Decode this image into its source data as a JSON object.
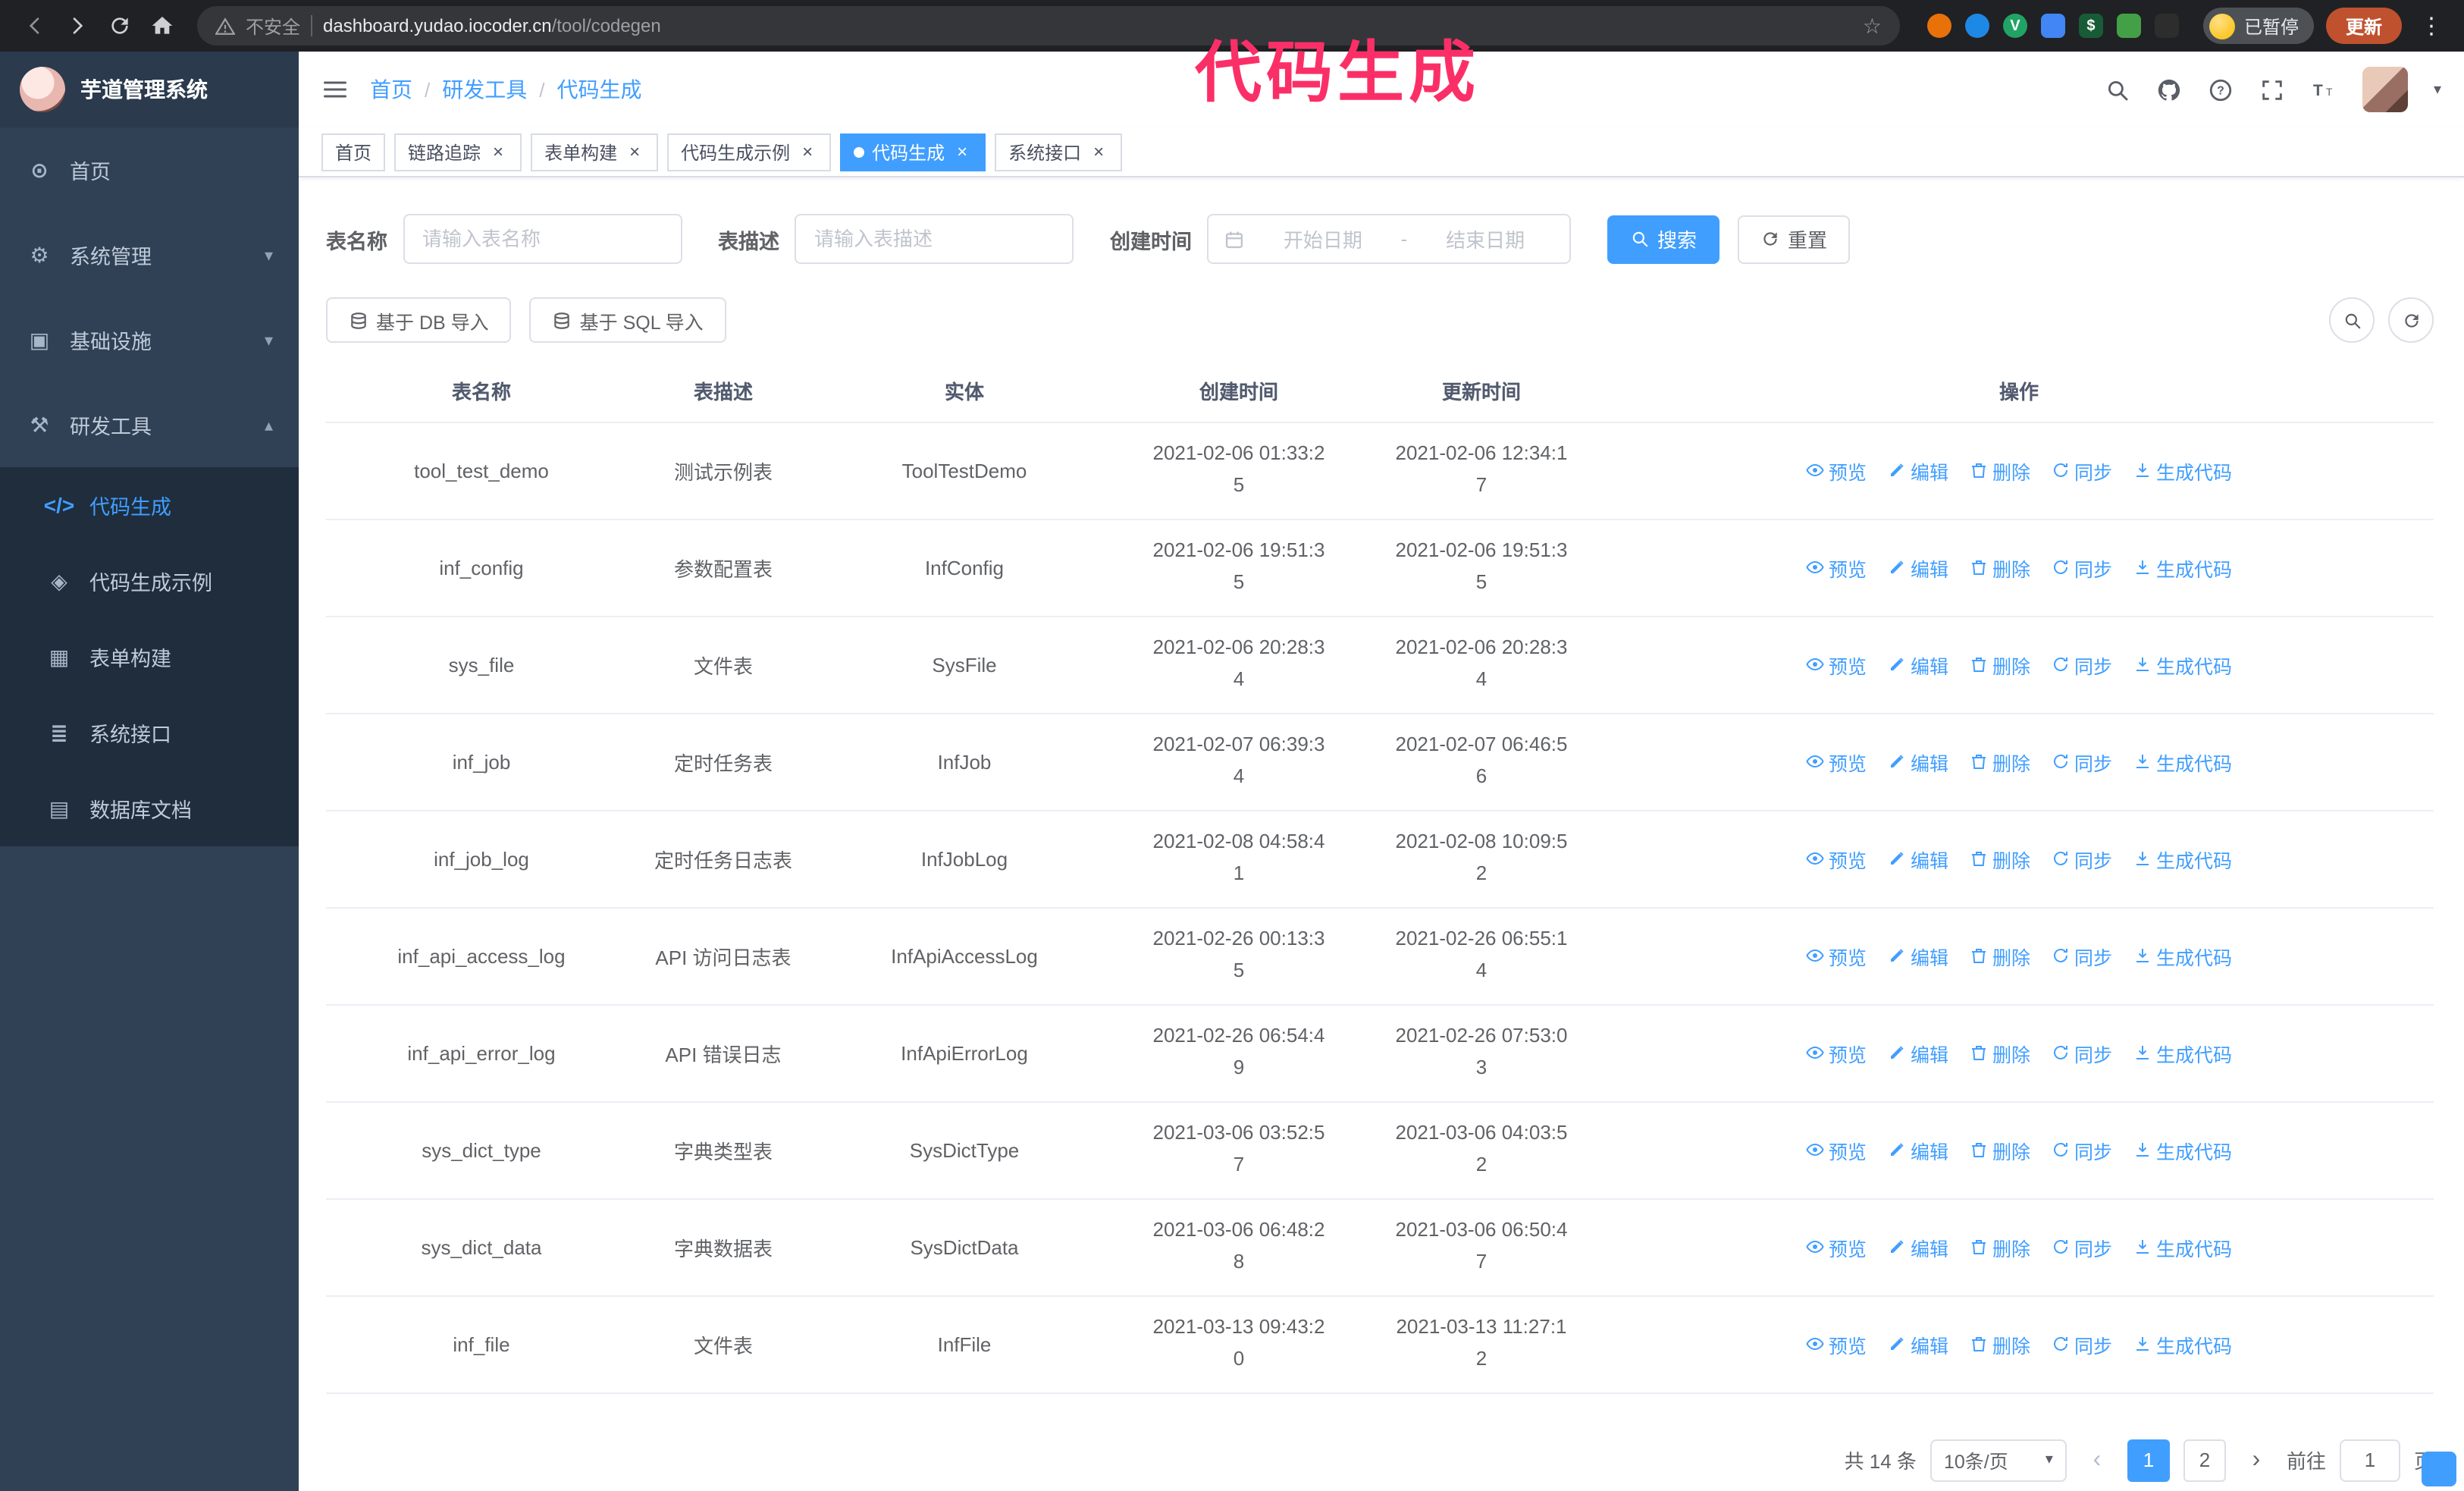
{
  "theme": {
    "primary": "#409EFF",
    "sidebar_bg": "#304156",
    "submenu_bg": "#1f2d3d",
    "overlay_color": "#fb2f67",
    "update_button_color": "#c0512f"
  },
  "browser": {
    "security_label": "不安全",
    "url_host": "dashboard.yudao.iocoder.cn",
    "url_path": "/tool/codegen",
    "paused_badge": "已暂停",
    "update_button": "更新",
    "extensions": [
      {
        "name": "extension-orange-icon",
        "color": "#e8710a",
        "shape": "circle",
        "glyph": ""
      },
      {
        "name": "extension-drop-icon",
        "color": "#1e88e5",
        "shape": "circle",
        "glyph": ""
      },
      {
        "name": "extension-v-green-icon",
        "color": "#21a366",
        "shape": "circle",
        "glyph": "V"
      },
      {
        "name": "extension-grid-blue-icon",
        "color": "#4285f4",
        "shape": "square",
        "glyph": ""
      },
      {
        "name": "extension-dark-green-icon",
        "color": "#185c37",
        "shape": "square",
        "glyph": "$"
      },
      {
        "name": "extension-leaf-icon",
        "color": "#43a047",
        "shape": "square",
        "glyph": ""
      },
      {
        "name": "extension-dark-icon",
        "color": "#2d2d2d",
        "shape": "square",
        "glyph": ""
      }
    ]
  },
  "overlay": {
    "title": "代码生成"
  },
  "sidebar": {
    "app_title": "芋道管理系统",
    "items": [
      {
        "key": "home",
        "label": "首页",
        "icon": "dashboard-icon"
      },
      {
        "key": "system",
        "label": "系统管理",
        "icon": "gear-icon",
        "chevron": "down"
      },
      {
        "key": "infra",
        "label": "基础设施",
        "icon": "monitor-icon",
        "chevron": "down"
      },
      {
        "key": "devtools",
        "label": "研发工具",
        "icon": "tools-icon",
        "chevron": "up",
        "open": true
      }
    ],
    "subitems": [
      {
        "key": "codegen",
        "label": "代码生成",
        "icon": "code-icon",
        "active": true
      },
      {
        "key": "codegen-example",
        "label": "代码生成示例",
        "icon": "example-icon"
      },
      {
        "key": "form-builder",
        "label": "表单构建",
        "icon": "form-icon"
      },
      {
        "key": "system-api",
        "label": "系统接口",
        "icon": "api-icon"
      },
      {
        "key": "db-doc",
        "label": "数据库文档",
        "icon": "database-icon"
      }
    ]
  },
  "header": {
    "breadcrumb": [
      {
        "label": "首页"
      },
      {
        "label": "研发工具"
      },
      {
        "label": "代码生成",
        "current": true
      }
    ],
    "icons": [
      "search-icon",
      "github-icon",
      "help-icon",
      "fullscreen-icon",
      "font-size-icon"
    ]
  },
  "tabs": [
    {
      "key": "home",
      "label": "首页",
      "closable": false
    },
    {
      "key": "tracer",
      "label": "链路追踪",
      "closable": true
    },
    {
      "key": "form-builder",
      "label": "表单构建",
      "closable": true
    },
    {
      "key": "codegen-example",
      "label": "代码生成示例",
      "closable": true
    },
    {
      "key": "codegen",
      "label": "代码生成",
      "closable": true,
      "active": true
    },
    {
      "key": "system-api",
      "label": "系统接口",
      "closable": true
    }
  ],
  "filters": {
    "table_name_label": "表名称",
    "table_name_placeholder": "请输入表名称",
    "table_desc_label": "表描述",
    "table_desc_placeholder": "请输入表描述",
    "create_time_label": "创建时间",
    "date_start_placeholder": "开始日期",
    "date_separator": "-",
    "date_end_placeholder": "结束日期",
    "search_button": "搜索",
    "reset_button": "重置"
  },
  "toolbar": {
    "import_db_label": "基于 DB 导入",
    "import_sql_label": "基于 SQL 导入"
  },
  "table": {
    "columns": [
      "表名称",
      "表描述",
      "实体",
      "创建时间",
      "更新时间",
      "操作"
    ],
    "actions": [
      {
        "key": "preview",
        "label": "预览",
        "icon": "eye-icon"
      },
      {
        "key": "edit",
        "label": "编辑",
        "icon": "edit-icon"
      },
      {
        "key": "delete",
        "label": "删除",
        "icon": "delete-icon"
      },
      {
        "key": "sync",
        "label": "同步",
        "icon": "sync-icon"
      },
      {
        "key": "generate",
        "label": "生成代码",
        "icon": "download-icon"
      }
    ],
    "rows": [
      {
        "name": "tool_test_demo",
        "desc": "测试示例表",
        "entity": "ToolTestDemo",
        "created": "2021-02-06 01:33:25",
        "updated": "2021-02-06 12:34:17"
      },
      {
        "name": "inf_config",
        "desc": "参数配置表",
        "entity": "InfConfig",
        "created": "2021-02-06 19:51:35",
        "updated": "2021-02-06 19:51:35"
      },
      {
        "name": "sys_file",
        "desc": "文件表",
        "entity": "SysFile",
        "created": "2021-02-06 20:28:34",
        "updated": "2021-02-06 20:28:34"
      },
      {
        "name": "inf_job",
        "desc": "定时任务表",
        "entity": "InfJob",
        "created": "2021-02-07 06:39:34",
        "updated": "2021-02-07 06:46:56"
      },
      {
        "name": "inf_job_log",
        "desc": "定时任务日志表",
        "entity": "InfJobLog",
        "created": "2021-02-08 04:58:41",
        "updated": "2021-02-08 10:09:52"
      },
      {
        "name": "inf_api_access_log",
        "desc": "API 访问日志表",
        "entity": "InfApiAccessLog",
        "created": "2021-02-26 00:13:35",
        "updated": "2021-02-26 06:55:14"
      },
      {
        "name": "inf_api_error_log",
        "desc": "API 错误日志",
        "entity": "InfApiErrorLog",
        "created": "2021-02-26 06:54:49",
        "updated": "2021-02-26 07:53:03"
      },
      {
        "name": "sys_dict_type",
        "desc": "字典类型表",
        "entity": "SysDictType",
        "created": "2021-03-06 03:52:57",
        "updated": "2021-03-06 04:03:52"
      },
      {
        "name": "sys_dict_data",
        "desc": "字典数据表",
        "entity": "SysDictData",
        "created": "2021-03-06 06:48:28",
        "updated": "2021-03-06 06:50:47"
      },
      {
        "name": "inf_file",
        "desc": "文件表",
        "entity": "InfFile",
        "created": "2021-03-13 09:43:20",
        "updated": "2021-03-13 11:27:12"
      }
    ]
  },
  "pagination": {
    "total": "共 14 条",
    "page_size": "10条/页",
    "pages": [
      {
        "label": "1",
        "active": true
      },
      {
        "label": "2",
        "active": false
      }
    ],
    "goto_label": "前往",
    "goto_value": "1",
    "unit_label": "页"
  }
}
